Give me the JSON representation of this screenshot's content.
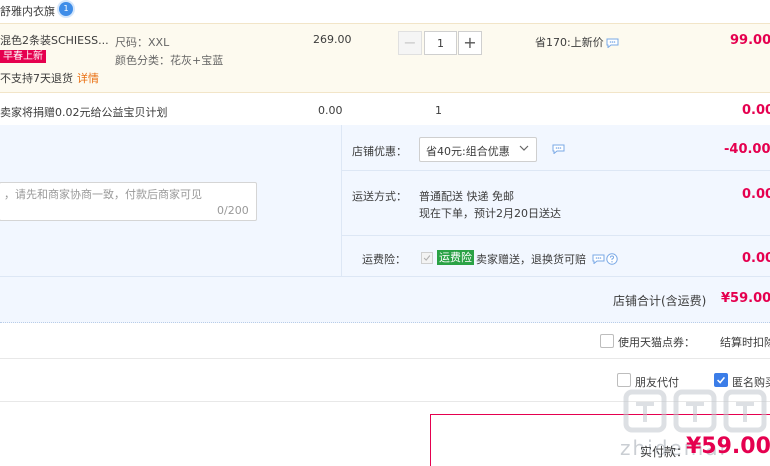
{
  "store": {
    "name": "舒雅内衣旗",
    "badge": "1"
  },
  "item": {
    "title": "混色2条装SCHIESS...",
    "promo_tag": "早春上新",
    "return_note": "不支持7天退货",
    "detail_link": "详情",
    "size": "尺码：XXL",
    "color": "颜色分类：花灰+宝蓝",
    "unit_price": "269.00",
    "quantity": "1",
    "qty_minus": "−",
    "qty_plus": "+",
    "discount_note": "省170:上新价",
    "subtotal": "99.00"
  },
  "charity": {
    "text": "卖家将捐赠0.02元给公益宝贝计划",
    "price": "0.00",
    "qty": "1",
    "subtotal": "0.00"
  },
  "memo": {
    "placeholder": "，请先和商家协商一致，付款后商家可见",
    "count": "0/200"
  },
  "shop_discount": {
    "label": "店铺优惠：",
    "selected": "省40元:组合优惠",
    "amount": "-40.00"
  },
  "shipping": {
    "label": "运送方式：",
    "method": "普通配送 快递 免邮",
    "eta": "现在下单，预计2月20日送达",
    "fee": "0.00"
  },
  "insurance": {
    "label": "运费险：",
    "tag": "运费险",
    "text": "卖家赠送，退换货可赔",
    "fee": "0.00"
  },
  "store_total": {
    "label": "店铺合计(含运费)",
    "value": "¥59.00"
  },
  "tmall_points": {
    "label": "使用天猫点券：",
    "deduct": "结算时扣除"
  },
  "friend_pay": {
    "label": "朋友代付"
  },
  "anonymous": {
    "label": "匿名购买",
    "checked": true
  },
  "payment": {
    "label": "实付款：",
    "amount": "¥59.00"
  },
  "watermark": {
    "text": "zhidemai"
  },
  "colors": {
    "accent_red": "#e5004f",
    "brand_blue": "#3b7de8",
    "insurance_green": "#2ba245",
    "options_bg": "#f2f7ff",
    "item_bg": "#fdfaef"
  },
  "icons": {
    "chat": "chat-bubble-icon",
    "help": "question-circle-icon",
    "dropdown": "chevron-down-icon",
    "check": "checkmark-icon"
  }
}
